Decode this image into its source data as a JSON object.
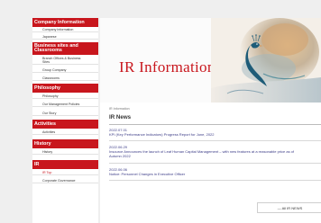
{
  "sidebar": {
    "sections": [
      {
        "title": "Company Information",
        "items": [
          {
            "label": "Company Information"
          },
          {
            "label": "Japanese"
          }
        ]
      },
      {
        "title_line1": "Business sites and",
        "title_line2": "Classrooms",
        "items": [
          {
            "label_line1": "Branch Offices & Business",
            "label_line2": "Sites"
          },
          {
            "label": "Group Company"
          },
          {
            "label": "Classrooms"
          }
        ]
      },
      {
        "title": "Philosophy",
        "items": [
          {
            "label": "Philosophy"
          },
          {
            "label": "Our Management Policies"
          },
          {
            "label": "Our Story"
          }
        ]
      },
      {
        "title": "Activities",
        "items": [
          {
            "label": "Activities"
          }
        ]
      },
      {
        "title": "History",
        "items": [
          {
            "label": "History"
          }
        ]
      },
      {
        "title": "IR",
        "items": [
          {
            "label": "IR Top"
          },
          {
            "label": "Corporate Governance"
          }
        ]
      }
    ]
  },
  "hero": {
    "title": "IR Information"
  },
  "breadcrumb": "IR Information",
  "news": {
    "heading": "IR News",
    "items": [
      {
        "date": "2022.07.01",
        "text": "KPI (Key Performance Indicators) Progress Report for June, 2022"
      },
      {
        "date": "2022.06.29",
        "text": "Insource Announces the launch of Leaf Human Capital Management – with new features at a reasonable price as of",
        "text2": "Autumn 2022"
      },
      {
        "date": "2022.06.06",
        "text": "Notice: Personnel Changes in Executive Officer"
      }
    ],
    "all_button": "— All IR NEWS"
  },
  "colors": {
    "accent": "#c8161d",
    "link": "#3d3d88"
  }
}
